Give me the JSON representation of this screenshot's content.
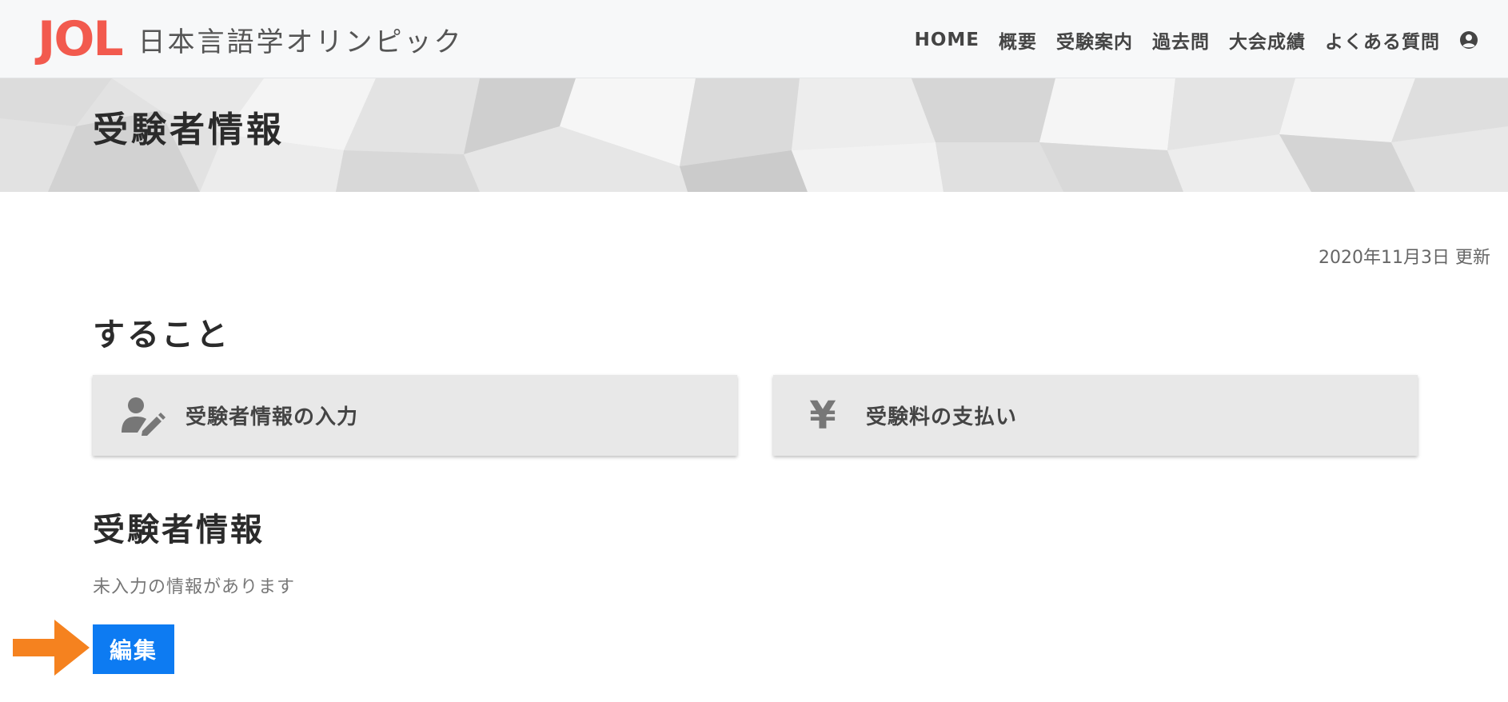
{
  "header": {
    "logo_mark": "JOL",
    "logo_text": "日本言語学オリンピック",
    "nav_items": [
      "HOME",
      "概要",
      "受験案内",
      "過去問",
      "大会成績",
      "よくある質問"
    ],
    "user_icon": "user-circle-icon"
  },
  "hero": {
    "title": "受験者情報"
  },
  "page": {
    "updated": "2020年11月3日 更新"
  },
  "todo": {
    "title": "すること",
    "cards": [
      {
        "label": "受験者情報の入力",
        "icon": "user-edit-icon"
      },
      {
        "label": "受験料の支払い",
        "icon": "yen-icon",
        "glyph": "¥"
      }
    ]
  },
  "info": {
    "title": "受験者情報",
    "notice": "未入力の情報があります",
    "edit_label": "編集"
  },
  "colors": {
    "brand": "#f25a4e",
    "button": "#0d7bf2",
    "arrow": "#f5821f"
  }
}
